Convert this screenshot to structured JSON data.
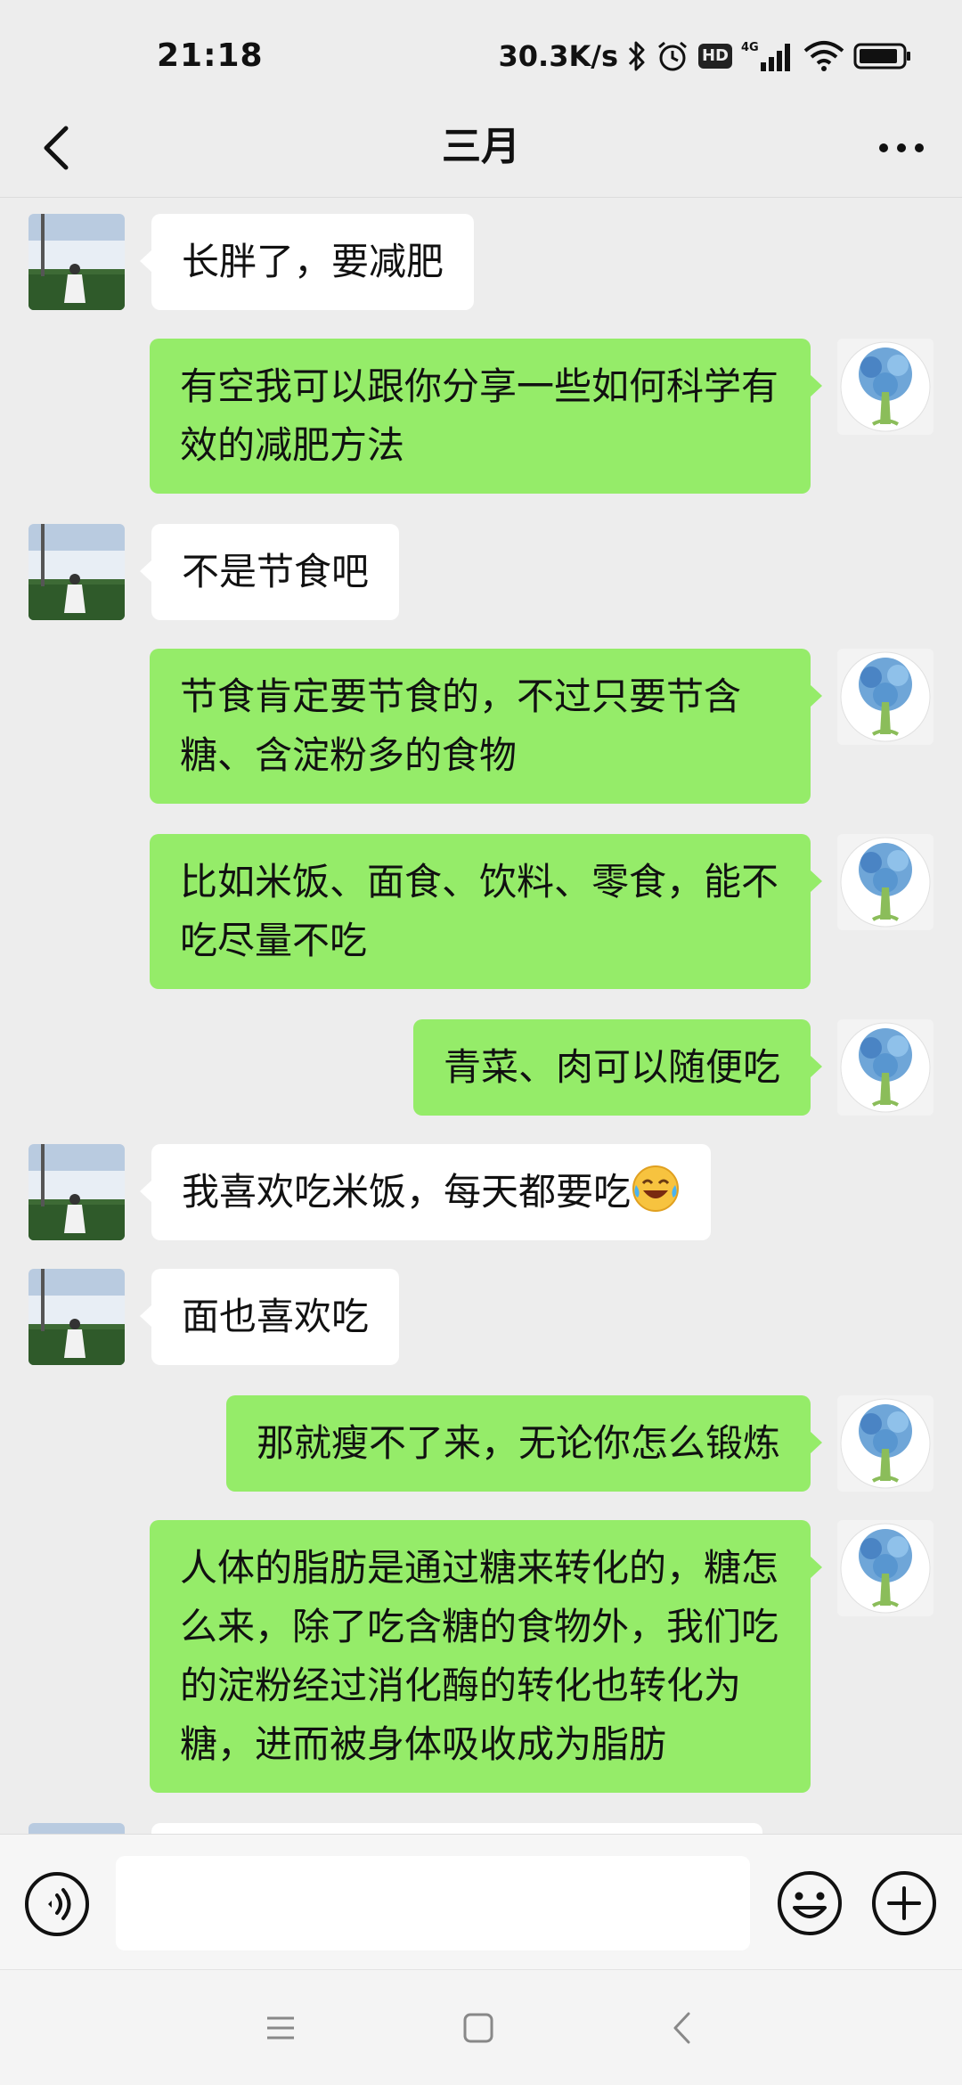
{
  "status_bar": {
    "time": "21:18",
    "net_speed": "30.3K/s",
    "icons": [
      "bluetooth-icon",
      "alarm-icon",
      "hd-badge",
      "signal-4g-icon",
      "wifi-icon",
      "battery-icon"
    ],
    "hd_label": "HD",
    "network_label": "4G"
  },
  "nav": {
    "title": "三月",
    "back_icon": "chevron-left-icon",
    "more_icon": "more-dots-icon"
  },
  "colors": {
    "background": "#ededed",
    "sent_bubble": "#95ec69",
    "received_bubble": "#ffffff"
  },
  "messages": [
    {
      "side": "left",
      "text": "长胖了，要减肥"
    },
    {
      "side": "right",
      "text": "有空我可以跟你分享一些如何科学有效的减肥方法"
    },
    {
      "side": "left",
      "text": "不是节食吧"
    },
    {
      "side": "right",
      "text": "节食肯定要节食的，不过只要节含糖、含淀粉多的食物"
    },
    {
      "side": "right",
      "text": "比如米饭、面食、饮料、零食，能不吃尽量不吃"
    },
    {
      "side": "right",
      "text": "青菜、肉可以随便吃"
    },
    {
      "side": "left",
      "text": "我喜欢吃米饭，每天都要吃",
      "emoji": "laughing-tears-emoji"
    },
    {
      "side": "left",
      "text": "面也喜欢吃"
    },
    {
      "side": "right",
      "text": "那就瘦不了来，无论你怎么锻炼"
    },
    {
      "side": "right",
      "text": "人体的脂肪是通过糖来转化的，糖怎么来，除了吃含糖的食物外，我们吃的淀粉经过消化酶的转化也转化为糖，进而被身体吸收成为脂肪"
    }
  ],
  "input_bar": {
    "value": "",
    "voice_icon": "voice-icon",
    "emoji_icon": "emoji-icon",
    "plus_icon": "plus-icon"
  },
  "system_nav": {
    "icons": [
      "menu-icon",
      "home-icon",
      "back-icon"
    ]
  }
}
